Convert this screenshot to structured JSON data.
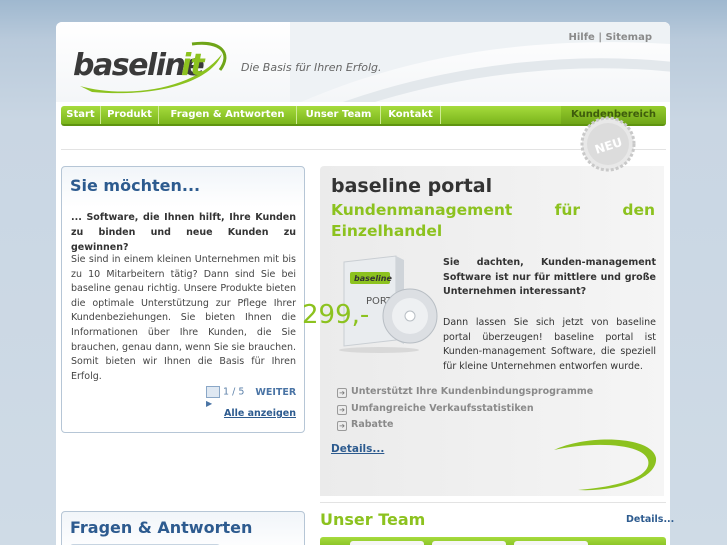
{
  "header": {
    "logo_text": "baseline",
    "logo_accent": "it",
    "tagline": "Die Basis für Ihren Erfolg.",
    "links": {
      "help": "Hilfe",
      "separator": "|",
      "sitemap": "Sitemap"
    }
  },
  "nav": {
    "items": [
      {
        "label": "Start"
      },
      {
        "label": "Produkt"
      },
      {
        "label": "Fragen & Antworten"
      },
      {
        "label": "Unser Team"
      },
      {
        "label": "Kontakt"
      }
    ],
    "right": "Kundenbereich"
  },
  "left_box": {
    "title": "Sie möchten...",
    "lead": "... Software, die Ihnen hilft, Ihre Kunden zu binden und neue Kunden zu gewinnen?",
    "body": "Sie sind in einem kleinen Unternehmen mit bis zu 10 Mitarbeitern tätig? Dann sind Sie bei baseline genau richtig. Unsere Produkte bieten die optimale Unterstützung zur Pflege Ihrer Kundenbeziehungen. Sie bieten Ihnen die Informationen über Ihre Kunden, die Sie brauchen, genau dann, wenn Sie sie brauchen. Somit bieten wir Ihnen die Basis für Ihren Erfolg.",
    "pager": {
      "current": "1",
      "sep": "/",
      "total": "5",
      "next": "WEITER"
    },
    "all_link": "Alle anzeigen"
  },
  "faq_box": {
    "title": "Fragen & Antworten"
  },
  "portal": {
    "badge": "NEU",
    "title": "baseline portal",
    "subtitle_line1": "Kundenmanagement für den",
    "subtitle_line2": "Einzelhandel",
    "boxart_brand": "baseline",
    "boxart_label": "PORT",
    "intro": "Sie dachten, Kunden-management Software ist nur für mittlere und große Unternehmen interessant?",
    "intro2": "Dann lassen Sie sich jetzt von baseline portal überzeugen! baseline portal ist Kunden-management Software, die speziell für kleine Unternehmen entworfen wurde.",
    "features": [
      "Unterstützt Ihre Kundenbindungsprogramme",
      "Umfangreiche Verkaufsstatistiken",
      "Rabatte"
    ],
    "details": "Details...",
    "price": "299,-"
  },
  "team": {
    "title": "Unser Team",
    "details": "Details..."
  },
  "colors": {
    "brand_green": "#8cc21f",
    "brand_blue": "#2d5b8f",
    "nav_green": "#7ab51b"
  }
}
